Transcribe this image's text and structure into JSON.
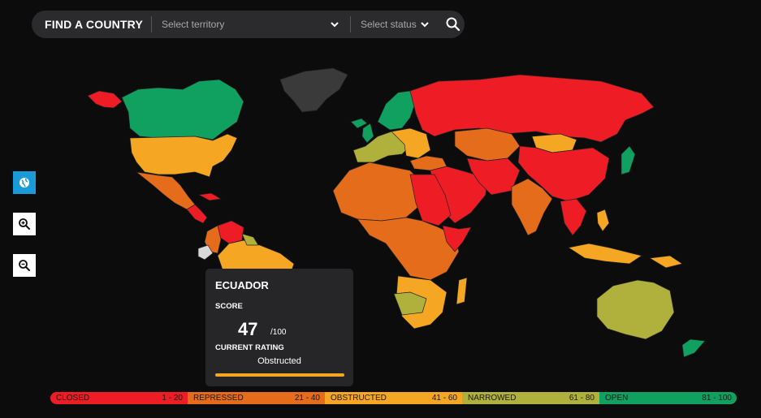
{
  "search": {
    "title": "FIND A COUNTRY",
    "territory_placeholder": "Select territory",
    "status_placeholder": "Select status"
  },
  "icons": {
    "globe": "globe-icon",
    "zoom_in": "zoom-in-icon",
    "zoom_out": "zoom-out-icon",
    "search": "search-icon",
    "chevron": "chevron-down-icon"
  },
  "tooltip": {
    "country": "ECUADOR",
    "score_label": "SCORE",
    "score": "47",
    "score_max": "/100",
    "rating_label": "CURRENT RATING",
    "rating": "Obstructed",
    "score_fraction": 0.47
  },
  "legend": [
    {
      "label": "CLOSED",
      "range": "1 - 20",
      "color": "#ee1c25"
    },
    {
      "label": "REPRESSED",
      "range": "21 - 40",
      "color": "#e46c1b"
    },
    {
      "label": "OBSTRUCTED",
      "range": "41 - 60",
      "color": "#f5a623"
    },
    {
      "label": "NARROWED",
      "range": "61 - 80",
      "color": "#b0b03c"
    },
    {
      "label": "OPEN",
      "range": "81 - 100",
      "color": "#10a060"
    }
  ],
  "map_colors": {
    "closed": "#ee1c25",
    "repressed": "#e46c1b",
    "obstructed": "#f5a623",
    "narrowed": "#b0b03c",
    "open": "#10a060",
    "no_data": "#3a3a3a",
    "selected": "#d9d9d9"
  }
}
